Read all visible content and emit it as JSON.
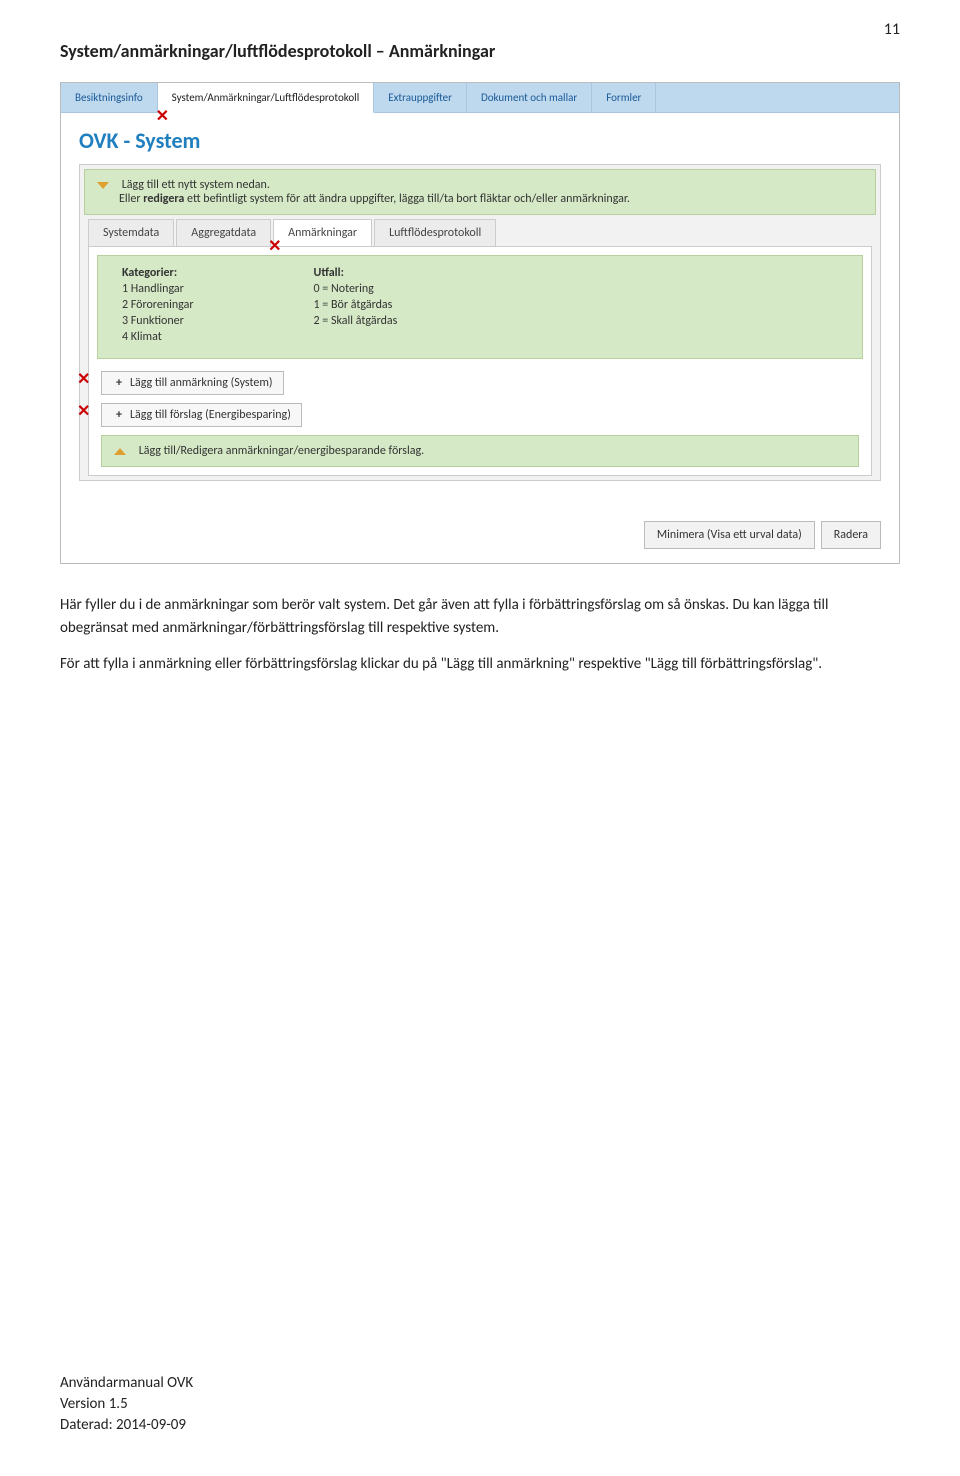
{
  "page_number": "11",
  "section_title": "System/anmärkningar/luftflödesprotokoll – Anmärkningar",
  "outer_tabs": {
    "t0": "Besiktningsinfo",
    "t1": "System/Anmärkningar/Luftflödesprotokoll",
    "t2": "Extrauppgifter",
    "t3": "Dokument och mallar",
    "t4": "Formler"
  },
  "ovk_heading": "OVK - System",
  "top_hint_line1": "Lägg till ett nytt system nedan.",
  "top_hint_line2_prefix": "Eller ",
  "top_hint_line2_bold": "redigera",
  "top_hint_line2_suffix": " ett befintligt system för att ändra uppgifter, lägga till/ta bort fläktar och/eller anmärkningar.",
  "inner_tabs": {
    "t0": "Systemdata",
    "t1": "Aggregatdata",
    "t2": "Anmärkningar",
    "t3": "Luftflödesprotokoll"
  },
  "categories": {
    "title": "Kategorier:",
    "i1": "1 Handlingar",
    "i2": "2 Föroreningar",
    "i3": "3 Funktioner",
    "i4": "4 Klimat"
  },
  "utfall": {
    "title": "Utfall:",
    "i0": "0 = Notering",
    "i1": "1 = Bör åtgärdas",
    "i2": "2 = Skall åtgärdas"
  },
  "add_system": "Lägg till anmärkning (System)",
  "add_energy": "Lägg till förslag (Energibesparing)",
  "bottom_hint": "Lägg till/Redigera anmärkningar/energibesparande förslag.",
  "btn_minimize": "Minimera (Visa ett urval data)",
  "btn_delete": "Radera",
  "para1": "Här fyller du i de anmärkningar som berör valt system. Det går även att fylla i förbättringsförslag om så önskas. Du kan lägga till obegränsat med anmärkningar/förbättringsförslag till respektive system.",
  "para2": "För att fylla i anmärkning eller förbättringsförslag klickar du på \"Lägg till anmärkning\" respektive \"Lägg till förbättringsförslag\".",
  "footer": {
    "l1": "Användarmanual OVK",
    "l2": "Version 1.5",
    "l3": "Daterad: 2014-09-09"
  }
}
